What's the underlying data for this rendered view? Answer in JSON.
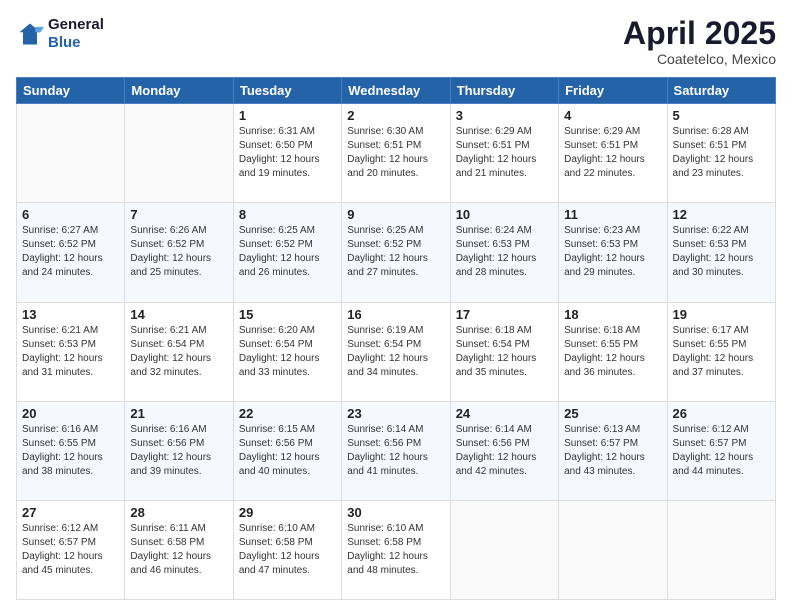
{
  "logo": {
    "line1": "General",
    "line2": "Blue"
  },
  "title": "April 2025",
  "subtitle": "Coatetelco, Mexico",
  "days_header": [
    "Sunday",
    "Monday",
    "Tuesday",
    "Wednesday",
    "Thursday",
    "Friday",
    "Saturday"
  ],
  "weeks": [
    [
      {
        "day": "",
        "sunrise": "",
        "sunset": "",
        "daylight": ""
      },
      {
        "day": "",
        "sunrise": "",
        "sunset": "",
        "daylight": ""
      },
      {
        "day": "1",
        "sunrise": "Sunrise: 6:31 AM",
        "sunset": "Sunset: 6:50 PM",
        "daylight": "Daylight: 12 hours and 19 minutes."
      },
      {
        "day": "2",
        "sunrise": "Sunrise: 6:30 AM",
        "sunset": "Sunset: 6:51 PM",
        "daylight": "Daylight: 12 hours and 20 minutes."
      },
      {
        "day": "3",
        "sunrise": "Sunrise: 6:29 AM",
        "sunset": "Sunset: 6:51 PM",
        "daylight": "Daylight: 12 hours and 21 minutes."
      },
      {
        "day": "4",
        "sunrise": "Sunrise: 6:29 AM",
        "sunset": "Sunset: 6:51 PM",
        "daylight": "Daylight: 12 hours and 22 minutes."
      },
      {
        "day": "5",
        "sunrise": "Sunrise: 6:28 AM",
        "sunset": "Sunset: 6:51 PM",
        "daylight": "Daylight: 12 hours and 23 minutes."
      }
    ],
    [
      {
        "day": "6",
        "sunrise": "Sunrise: 6:27 AM",
        "sunset": "Sunset: 6:52 PM",
        "daylight": "Daylight: 12 hours and 24 minutes."
      },
      {
        "day": "7",
        "sunrise": "Sunrise: 6:26 AM",
        "sunset": "Sunset: 6:52 PM",
        "daylight": "Daylight: 12 hours and 25 minutes."
      },
      {
        "day": "8",
        "sunrise": "Sunrise: 6:25 AM",
        "sunset": "Sunset: 6:52 PM",
        "daylight": "Daylight: 12 hours and 26 minutes."
      },
      {
        "day": "9",
        "sunrise": "Sunrise: 6:25 AM",
        "sunset": "Sunset: 6:52 PM",
        "daylight": "Daylight: 12 hours and 27 minutes."
      },
      {
        "day": "10",
        "sunrise": "Sunrise: 6:24 AM",
        "sunset": "Sunset: 6:53 PM",
        "daylight": "Daylight: 12 hours and 28 minutes."
      },
      {
        "day": "11",
        "sunrise": "Sunrise: 6:23 AM",
        "sunset": "Sunset: 6:53 PM",
        "daylight": "Daylight: 12 hours and 29 minutes."
      },
      {
        "day": "12",
        "sunrise": "Sunrise: 6:22 AM",
        "sunset": "Sunset: 6:53 PM",
        "daylight": "Daylight: 12 hours and 30 minutes."
      }
    ],
    [
      {
        "day": "13",
        "sunrise": "Sunrise: 6:21 AM",
        "sunset": "Sunset: 6:53 PM",
        "daylight": "Daylight: 12 hours and 31 minutes."
      },
      {
        "day": "14",
        "sunrise": "Sunrise: 6:21 AM",
        "sunset": "Sunset: 6:54 PM",
        "daylight": "Daylight: 12 hours and 32 minutes."
      },
      {
        "day": "15",
        "sunrise": "Sunrise: 6:20 AM",
        "sunset": "Sunset: 6:54 PM",
        "daylight": "Daylight: 12 hours and 33 minutes."
      },
      {
        "day": "16",
        "sunrise": "Sunrise: 6:19 AM",
        "sunset": "Sunset: 6:54 PM",
        "daylight": "Daylight: 12 hours and 34 minutes."
      },
      {
        "day": "17",
        "sunrise": "Sunrise: 6:18 AM",
        "sunset": "Sunset: 6:54 PM",
        "daylight": "Daylight: 12 hours and 35 minutes."
      },
      {
        "day": "18",
        "sunrise": "Sunrise: 6:18 AM",
        "sunset": "Sunset: 6:55 PM",
        "daylight": "Daylight: 12 hours and 36 minutes."
      },
      {
        "day": "19",
        "sunrise": "Sunrise: 6:17 AM",
        "sunset": "Sunset: 6:55 PM",
        "daylight": "Daylight: 12 hours and 37 minutes."
      }
    ],
    [
      {
        "day": "20",
        "sunrise": "Sunrise: 6:16 AM",
        "sunset": "Sunset: 6:55 PM",
        "daylight": "Daylight: 12 hours and 38 minutes."
      },
      {
        "day": "21",
        "sunrise": "Sunrise: 6:16 AM",
        "sunset": "Sunset: 6:56 PM",
        "daylight": "Daylight: 12 hours and 39 minutes."
      },
      {
        "day": "22",
        "sunrise": "Sunrise: 6:15 AM",
        "sunset": "Sunset: 6:56 PM",
        "daylight": "Daylight: 12 hours and 40 minutes."
      },
      {
        "day": "23",
        "sunrise": "Sunrise: 6:14 AM",
        "sunset": "Sunset: 6:56 PM",
        "daylight": "Daylight: 12 hours and 41 minutes."
      },
      {
        "day": "24",
        "sunrise": "Sunrise: 6:14 AM",
        "sunset": "Sunset: 6:56 PM",
        "daylight": "Daylight: 12 hours and 42 minutes."
      },
      {
        "day": "25",
        "sunrise": "Sunrise: 6:13 AM",
        "sunset": "Sunset: 6:57 PM",
        "daylight": "Daylight: 12 hours and 43 minutes."
      },
      {
        "day": "26",
        "sunrise": "Sunrise: 6:12 AM",
        "sunset": "Sunset: 6:57 PM",
        "daylight": "Daylight: 12 hours and 44 minutes."
      }
    ],
    [
      {
        "day": "27",
        "sunrise": "Sunrise: 6:12 AM",
        "sunset": "Sunset: 6:57 PM",
        "daylight": "Daylight: 12 hours and 45 minutes."
      },
      {
        "day": "28",
        "sunrise": "Sunrise: 6:11 AM",
        "sunset": "Sunset: 6:58 PM",
        "daylight": "Daylight: 12 hours and 46 minutes."
      },
      {
        "day": "29",
        "sunrise": "Sunrise: 6:10 AM",
        "sunset": "Sunset: 6:58 PM",
        "daylight": "Daylight: 12 hours and 47 minutes."
      },
      {
        "day": "30",
        "sunrise": "Sunrise: 6:10 AM",
        "sunset": "Sunset: 6:58 PM",
        "daylight": "Daylight: 12 hours and 48 minutes."
      },
      {
        "day": "",
        "sunrise": "",
        "sunset": "",
        "daylight": ""
      },
      {
        "day": "",
        "sunrise": "",
        "sunset": "",
        "daylight": ""
      },
      {
        "day": "",
        "sunrise": "",
        "sunset": "",
        "daylight": ""
      }
    ]
  ]
}
